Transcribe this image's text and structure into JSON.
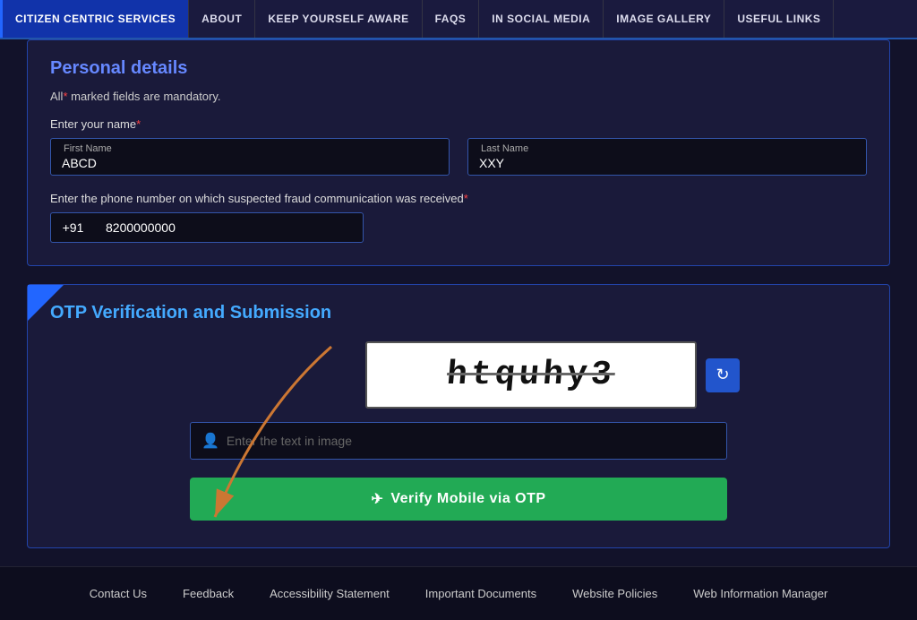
{
  "navbar": {
    "items": [
      {
        "id": "citizen-centric",
        "label": "Citizen Centric Services",
        "active": true
      },
      {
        "id": "about",
        "label": "About",
        "active": false
      },
      {
        "id": "keep-aware",
        "label": "Keep Yourself Aware",
        "active": false
      },
      {
        "id": "faqs",
        "label": "FAQs",
        "active": false
      },
      {
        "id": "social-media",
        "label": "In Social Media",
        "active": false
      },
      {
        "id": "image-gallery",
        "label": "Image Gallery",
        "active": false
      },
      {
        "id": "useful-links",
        "label": "Useful Links",
        "active": false
      }
    ]
  },
  "personal_details": {
    "title": "Personal details",
    "mandatory_note": "All",
    "mandatory_star": "*",
    "mandatory_rest": " marked fields are mandatory.",
    "name_label": "Enter your name",
    "first_name_label": "First Name",
    "first_name_value": "ABCD",
    "last_name_label": "Last Name",
    "last_name_value": "XXY",
    "phone_label": "Enter the phone number on which suspected fraud communication was received",
    "phone_prefix": "+91",
    "phone_value": "8200000000"
  },
  "otp_section": {
    "title": "OTP Verification and Submission",
    "captcha_text": "htquhy3",
    "captcha_input_placeholder": "Enter the text in image",
    "refresh_icon": "↻",
    "user_icon": "👤",
    "verify_button_label": "Verify Mobile via OTP",
    "send_icon": "✉"
  },
  "footer": {
    "links": [
      {
        "id": "contact-us",
        "label": "Contact Us"
      },
      {
        "id": "feedback",
        "label": "Feedback"
      },
      {
        "id": "accessibility",
        "label": "Accessibility Statement"
      },
      {
        "id": "important-docs",
        "label": "Important Documents"
      },
      {
        "id": "website-policies",
        "label": "Website Policies"
      },
      {
        "id": "web-info-manager",
        "label": "Web Information Manager"
      }
    ]
  }
}
